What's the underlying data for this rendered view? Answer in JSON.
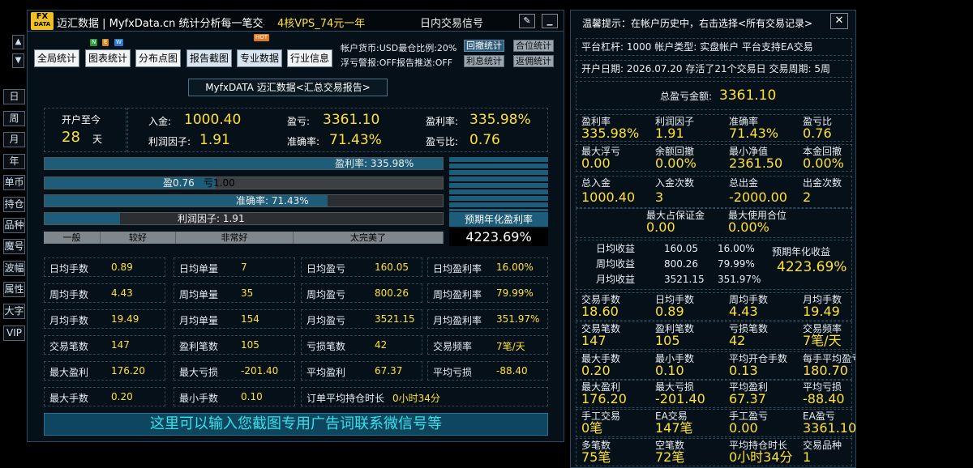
{
  "sidebar": {
    "items": [
      "日",
      "周",
      "月",
      "年",
      "单币",
      "持仓",
      "品种",
      "魔号",
      "波幅",
      "属性",
      "大字",
      "VIP"
    ]
  },
  "titlebar": {
    "logo_top": "FX",
    "logo_bottom": "DATA",
    "app_title": "迈汇数据 | MyfxData.cn  统计分析每一笔交易",
    "promo": "4核VPS_74元一年",
    "signal": "日内交易信号",
    "minimize_symbol": "_",
    "edit_symbol": "✎"
  },
  "nav": {
    "items": [
      "全局统计",
      "图表统计",
      "分布点图",
      "报告截图",
      "专业数据",
      "行业信息"
    ],
    "badge_new": "N",
    "badge_e": "E",
    "badge_w": "W",
    "badge_hot": "HOT"
  },
  "account": {
    "line1": "帐户货币:USD最仓比例:20%",
    "line2": "浮亏警报:OFF报告推送:OFF",
    "btn_callback": "回撤统计",
    "btn_position": "合位统计",
    "btn_interest": "利息统计",
    "btn_rebate": "返佣统计"
  },
  "report": {
    "title": "MyfxDATA 迈汇数据<汇总交易报告>"
  },
  "summary": {
    "since_open": "开户至今",
    "days_value": "28",
    "days_unit": "天",
    "deposit_label": "入金:",
    "deposit_value": "1000.40",
    "profit_label": "盈亏:",
    "profit_value": "3361.10",
    "profit_rate_label": "盈利率:",
    "profit_rate_value": "335.98%",
    "pf_label": "利润因子:",
    "pf_value": "1.91",
    "accuracy_label": "准确率:",
    "accuracy_value": "71.43%",
    "pl_ratio_label": "盈亏比:",
    "pl_ratio_value": "0.76"
  },
  "bars": {
    "profit_rate_text": "盈利率: 335.98%",
    "profit_rate_fill": 1.0,
    "win_text": "盈0.76",
    "loss_text": "亏1.00",
    "win_fill": 0.43,
    "accuracy_text": "准确率: 71.43%",
    "accuracy_fill": 0.71,
    "pf_text": "利润因子: 1.91",
    "pf_fill": 0.19
  },
  "grades": [
    "一般",
    "较好",
    "非常好",
    "太完美了"
  ],
  "expected": {
    "label": "预期年化盈利率",
    "value": "4223.69%"
  },
  "grid": [
    [
      "日均手数",
      "0.89",
      "日均单量",
      "7",
      "日均盈亏",
      "160.05",
      "日均盈利率",
      "16.00%"
    ],
    [
      "周均手数",
      "4.43",
      "周均单量",
      "35",
      "周均盈亏",
      "800.26",
      "周均盈利率",
      "79.99%"
    ],
    [
      "月均手数",
      "19.49",
      "月均单量",
      "154",
      "月均盈亏",
      "3521.15",
      "月均盈利率",
      "351.97%"
    ],
    [
      "交易笔数",
      "147",
      "盈利笔数",
      "105",
      "亏损笔数",
      "42",
      "交易频率",
      "7笔/天"
    ],
    [
      "最大盈利",
      "176.20",
      "最大亏损",
      "-201.40",
      "平均盈利",
      "67.37",
      "平均亏损",
      "-88.40"
    ]
  ],
  "lastrow": {
    "l1": "最大手数",
    "v1": "0.20",
    "l2": "最小手数",
    "v2": "0.10",
    "l3": "订单平均持仓时长",
    "v3": "0小时34分"
  },
  "ad": {
    "text": "这里可以输入您截图专用广告词联系微信号等"
  },
  "right": {
    "tip": "温馨提示：在帐户历史中，右击选择<所有交易记录>",
    "close_symbol": "✕",
    "line1": "平台杠杆: 1000   帐户类型: 实盘帐户    平台支持EA交易",
    "line2": "开户日期: 2026.07.20 存活了21个交易日  交易周期: 5周",
    "total_label": "总盈亏金额:",
    "total_value": "3361.10",
    "r1": [
      [
        "盈利率",
        "335.98%"
      ],
      [
        "利润因子",
        "1.91"
      ],
      [
        "准确率",
        "71.43%"
      ],
      [
        "盈亏比",
        "0.76"
      ]
    ],
    "r2": [
      [
        "最大浮亏",
        "0.00"
      ],
      [
        "余额回撤",
        "0.00%"
      ],
      [
        "最小净值",
        "2361.50"
      ],
      [
        "本金回撤",
        "0.00%"
      ]
    ],
    "r3": [
      [
        "总入金",
        "1000.40"
      ],
      [
        "入金次数",
        "3"
      ],
      [
        "总出金",
        "-2000.00"
      ],
      [
        "出金次数",
        "2"
      ]
    ],
    "r4": [
      [
        "最大占保证金",
        "0.00"
      ],
      [
        "最大使用合位",
        "0.00%"
      ]
    ],
    "income": [
      [
        "日均收益",
        "160.05",
        "16.00%"
      ],
      [
        "周均收益",
        "800.26",
        "79.99%"
      ],
      [
        "月均收益",
        "3521.15",
        "351.97%"
      ]
    ],
    "income_expected_label": "预期年化收益",
    "income_expected_value": "4223.69%",
    "r5": [
      [
        "交易手数",
        "18.60"
      ],
      [
        "日均手数",
        "0.89"
      ],
      [
        "周均手数",
        "4.43"
      ],
      [
        "月均手数",
        "19.49"
      ]
    ],
    "r6": [
      [
        "交易笔数",
        "147"
      ],
      [
        "盈利笔数",
        "105"
      ],
      [
        "亏损笔数",
        "42"
      ],
      [
        "交易频率",
        "7笔/天"
      ]
    ],
    "r7": [
      [
        "最大手数",
        "0.20"
      ],
      [
        "最小手数",
        "0.10"
      ],
      [
        "平均开仓手数",
        "0.13"
      ],
      [
        "每手平均盈亏",
        "180.70"
      ]
    ],
    "r8": [
      [
        "最大盈利",
        "176.20"
      ],
      [
        "最大亏损",
        "-201.40"
      ],
      [
        "平均盈利",
        "67.37"
      ],
      [
        "平均亏损",
        "-88.40"
      ]
    ],
    "r9": [
      [
        "手工交易",
        "0笔"
      ],
      [
        "EA交易",
        "147笔"
      ],
      [
        "手工盈亏",
        "0.00"
      ],
      [
        "EA盈亏",
        "3361.10"
      ]
    ],
    "r10": [
      [
        "多笔数",
        "75笔"
      ],
      [
        "空笔数",
        "72笔"
      ],
      [
        "平均持仓时长",
        "0小时34分"
      ],
      [
        "交易品种",
        "1"
      ]
    ]
  },
  "colors": {
    "accent_yellow": "#ffe033",
    "bar_blue": "#1e5d7a",
    "panel_bg": "#061018",
    "ad_bg": "#0e4660",
    "ad_text": "#38e0e8"
  },
  "icons": [
    "arrow-up-icon",
    "arrow-down-icon",
    "edit-icon",
    "minimize-icon",
    "close-icon"
  ]
}
